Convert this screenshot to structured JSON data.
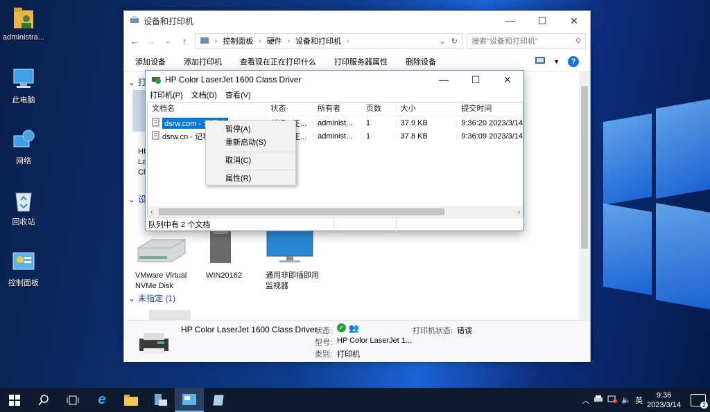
{
  "desktop": {
    "icons": [
      {
        "label": "administra..."
      },
      {
        "label": "此电脑"
      },
      {
        "label": "网络"
      },
      {
        "label": "回收站"
      },
      {
        "label": "控制面板"
      }
    ]
  },
  "explorer": {
    "title": "设备和打印机",
    "breadcrumb": [
      "控制面板",
      "硬件",
      "设备和打印机"
    ],
    "search_placeholder": "搜索\"设备和打印机\"",
    "commands": [
      "添加设备",
      "添加打印机",
      "查看现在正在打印什么",
      "打印服务器属性",
      "删除设备"
    ],
    "groups": {
      "printers_partial": "打",
      "devices_partial": "设",
      "unspecified": "未指定 (1)"
    },
    "printer_partial_label": [
      "HP",
      "La",
      "Cl"
    ],
    "devices": [
      {
        "label": "VMware Virtual NVMe Disk"
      },
      {
        "label": "WIN20162"
      },
      {
        "label": "通用非即插即用监视器"
      }
    ],
    "details": {
      "name": "HP Color LaserJet 1600 Class Driver",
      "status_label": "状态:",
      "printer_status_label": "打印机状态:",
      "printer_status_value": "错误",
      "model_label": "型号:",
      "model_value": "HP Color LaserJet 1...",
      "category_label": "类别:",
      "category_value": "打印机"
    }
  },
  "queue": {
    "title": "HP Color LaserJet 1600 Class Driver",
    "menu": [
      "打印机(P)",
      "文档(D)",
      "查看(V)"
    ],
    "columns": [
      "文档名",
      "状态",
      "所有者",
      "页数",
      "大小",
      "提交时间"
    ],
    "rows": [
      {
        "name": "dsrw.com - 记事本",
        "status": "错误 - 正...",
        "owner": "administ...",
        "pages": "1",
        "size": "37.9 KB",
        "time": "9:36:20  2023/3/14"
      },
      {
        "name": "dsrw.cn - 记事本",
        "status": "错误 - 正...",
        "owner": "administ...",
        "pages": "1",
        "size": "37.8 KB",
        "time": "9:36:09  2023/3/14"
      }
    ],
    "status_text": "队列中有 2 个文档"
  },
  "context_menu": {
    "items": [
      "暂停(A)",
      "重新启动(S)",
      "取消(C)",
      "属性(R)"
    ]
  },
  "taskbar": {
    "ime": "英",
    "time": "9:36",
    "date": "2023/3/14",
    "notifications": "2"
  }
}
